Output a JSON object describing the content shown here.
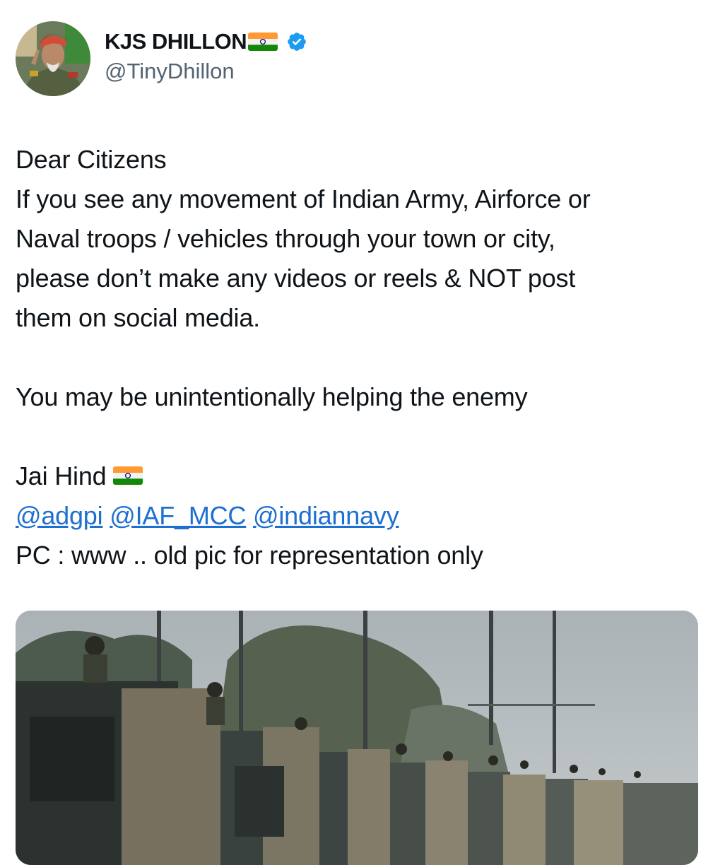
{
  "author": {
    "display_name": "KJS DHILLON",
    "handle": "@TinyDhillon",
    "flag_emoji": "🇮🇳",
    "verified": true,
    "avatar_icon": "avatar-portrait-icon"
  },
  "tweet": {
    "greeting": "Dear Citizens",
    "body_lines": [
      "If you see any movement of Indian Army, Airforce or",
      "Naval troops / vehicles through your town or city,",
      "please don’t make any videos or reels & NOT post",
      "them on social media."
    ],
    "warning": "You may be unintentionally helping the enemy",
    "signoff": "Jai Hind",
    "mentions": [
      "@adgpi",
      "@IAF_MCC",
      "@indiannavy"
    ],
    "photo_credit": "PC : www .. old pic for representation only"
  },
  "colors": {
    "text": "#0f1419",
    "secondary": "#536471",
    "link": "#1d6fd0",
    "verified": "#1d9bf0"
  }
}
